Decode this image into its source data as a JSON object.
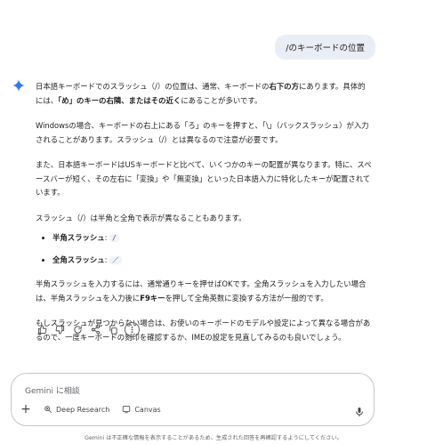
{
  "user_message": "/のキーボードの位置",
  "answer": {
    "p1_a": "日本語キーボードでのスラッシュ（/）の位置は、通常、キーボードの",
    "p1_b": "右下の方",
    "p1_c": "にあります。具体的には、",
    "p1_d": "「め」のキーの右隣、またはその近く",
    "p1_e": "にあることが多いです。",
    "p2": "Windowsの場合、キーボードの右上にある「ろ」のキーを押すと、「\\」（バックスラッシュ）が入力されることがあります。スラッシュ（/）とは異なるので注意が必要です。",
    "p3": "また、日本語キーボードはUSキーボードと比べて、いくつかのキーの配置が異なります。特に、スペースバーが短く、その左右に「変換」や「無変換」といった日本語入力に特化したキーが配置されています。",
    "p4": "スラッシュ（/）は半角と全角で表示が異なることもあります。",
    "list": [
      {
        "label": "半角スラッシュ",
        "sep": ": ",
        "code": "/"
      },
      {
        "label": "全角スラッシュ",
        "sep": ": ",
        "code": "／"
      }
    ],
    "p5_a": "半角スラッシュを入力するには、通常通りキーを押せばOKです。全角スラッシュを入力したい場合は、半角スラッシュを入力後に",
    "p5_b": "F9キー",
    "p5_c": "を押して全角英数に変換する方法が一般的です。",
    "p6": "もしスラッシュが見つからない場合は、お使いのキーボードのモデルや設定によって異なる場合があるので、一度キーボードの刻印を確認するか、IMEの設定を見直してみるのも良いでしょう。"
  },
  "actions": [
    "thumb-up-icon",
    "thumb-down-icon",
    "redo-icon",
    "share-icon",
    "copy-icon",
    "more-vert-icon"
  ],
  "input": {
    "placeholder": "Gemini に相談",
    "tools": [
      {
        "label": "Deep Research",
        "icon": "deep-research-icon"
      },
      {
        "label": "Canvas",
        "icon": "canvas-icon"
      }
    ]
  },
  "disclaimer": "Gemini は不正確な情報を表示することがあるため、生成された回答を再確認するようにしてください。",
  "colors": {
    "accent": "#1a73e8",
    "bubble": "#e9eef6",
    "text": "#1f1f1f",
    "muted": "#5f6368"
  }
}
